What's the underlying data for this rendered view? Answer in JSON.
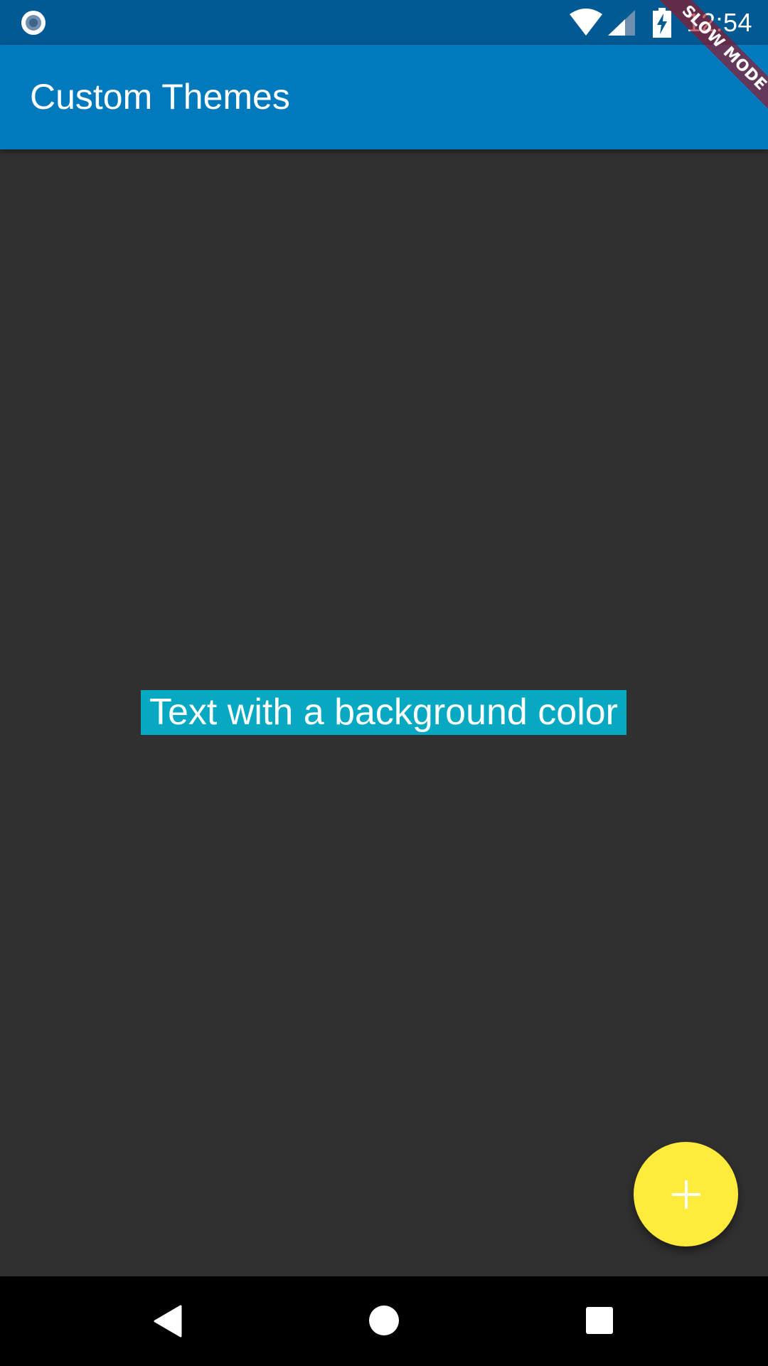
{
  "status_bar": {
    "time": "12:54",
    "left_icon": "notification-circle-icon",
    "icons": [
      "wifi-icon",
      "cell-signal-icon",
      "battery-charging-icon"
    ]
  },
  "app_bar": {
    "title": "Custom Themes"
  },
  "debug_banner": {
    "label": "SLOW MODE"
  },
  "main": {
    "text": "Text with a background color",
    "text_background": "#06a8c2"
  },
  "fab": {
    "icon": "plus-icon",
    "color": "#ffeb3b"
  },
  "nav_bar": {
    "buttons": [
      "back-icon",
      "home-icon",
      "recents-icon"
    ]
  },
  "colors": {
    "status_bar": "#015a93",
    "app_bar": "#0179bd",
    "background": "#303030"
  }
}
